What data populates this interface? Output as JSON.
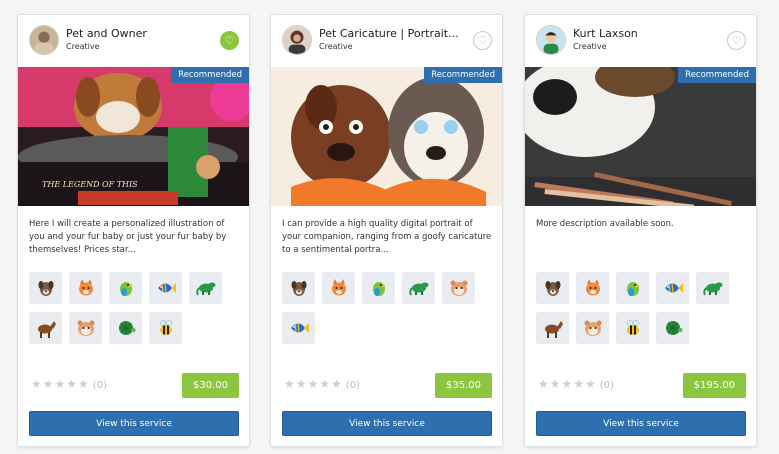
{
  "cards": [
    {
      "seller_name": "Pet and Owner",
      "seller_category": "Creative",
      "favorited": true,
      "badge": "Recommended",
      "image_text": "THE LEGEND OF THIS",
      "description": "Here I will create a personalized illustration of you and your fur baby or just your fur baby by themselves! Prices star...",
      "pets": [
        "dog-icon",
        "cat-icon",
        "bird-icon",
        "fish-icon",
        "reptile-icon",
        "horse-icon",
        "hamster-icon",
        "turtle-icon",
        "bee-icon"
      ],
      "stars": "★★★★★",
      "review_count": "(0)",
      "price": "$30.00",
      "button_label": "View this service"
    },
    {
      "seller_name": "Pet Caricature | Portrait...",
      "seller_category": "Creative",
      "favorited": false,
      "badge": "Recommended",
      "description": "I can provide a high quality digital portrait of your companion, ranging from a goofy caricature to a sentimental portra...",
      "pets": [
        "dog-icon",
        "cat-icon",
        "bird-icon",
        "reptile-icon",
        "hamster-icon",
        "fish-icon"
      ],
      "stars": "★★★★★",
      "review_count": "(0)",
      "price": "$35.00",
      "button_label": "View this service"
    },
    {
      "seller_name": "Kurt Laxson",
      "seller_category": "Creative",
      "favorited": false,
      "badge": "Recommended",
      "description": "More description available soon.",
      "pets": [
        "dog-icon",
        "cat-icon",
        "bird-icon",
        "fish-icon",
        "reptile-icon",
        "horse-icon",
        "hamster-icon",
        "bee-icon",
        "turtle-icon"
      ],
      "stars": "★★★★★",
      "review_count": "(0)",
      "price": "$195.00",
      "button_label": "View this service"
    }
  ],
  "colors": {
    "accent_blue": "#2e6fb0",
    "price_green": "#8cc63f",
    "pet_tile_bg": "#e9edf2"
  }
}
